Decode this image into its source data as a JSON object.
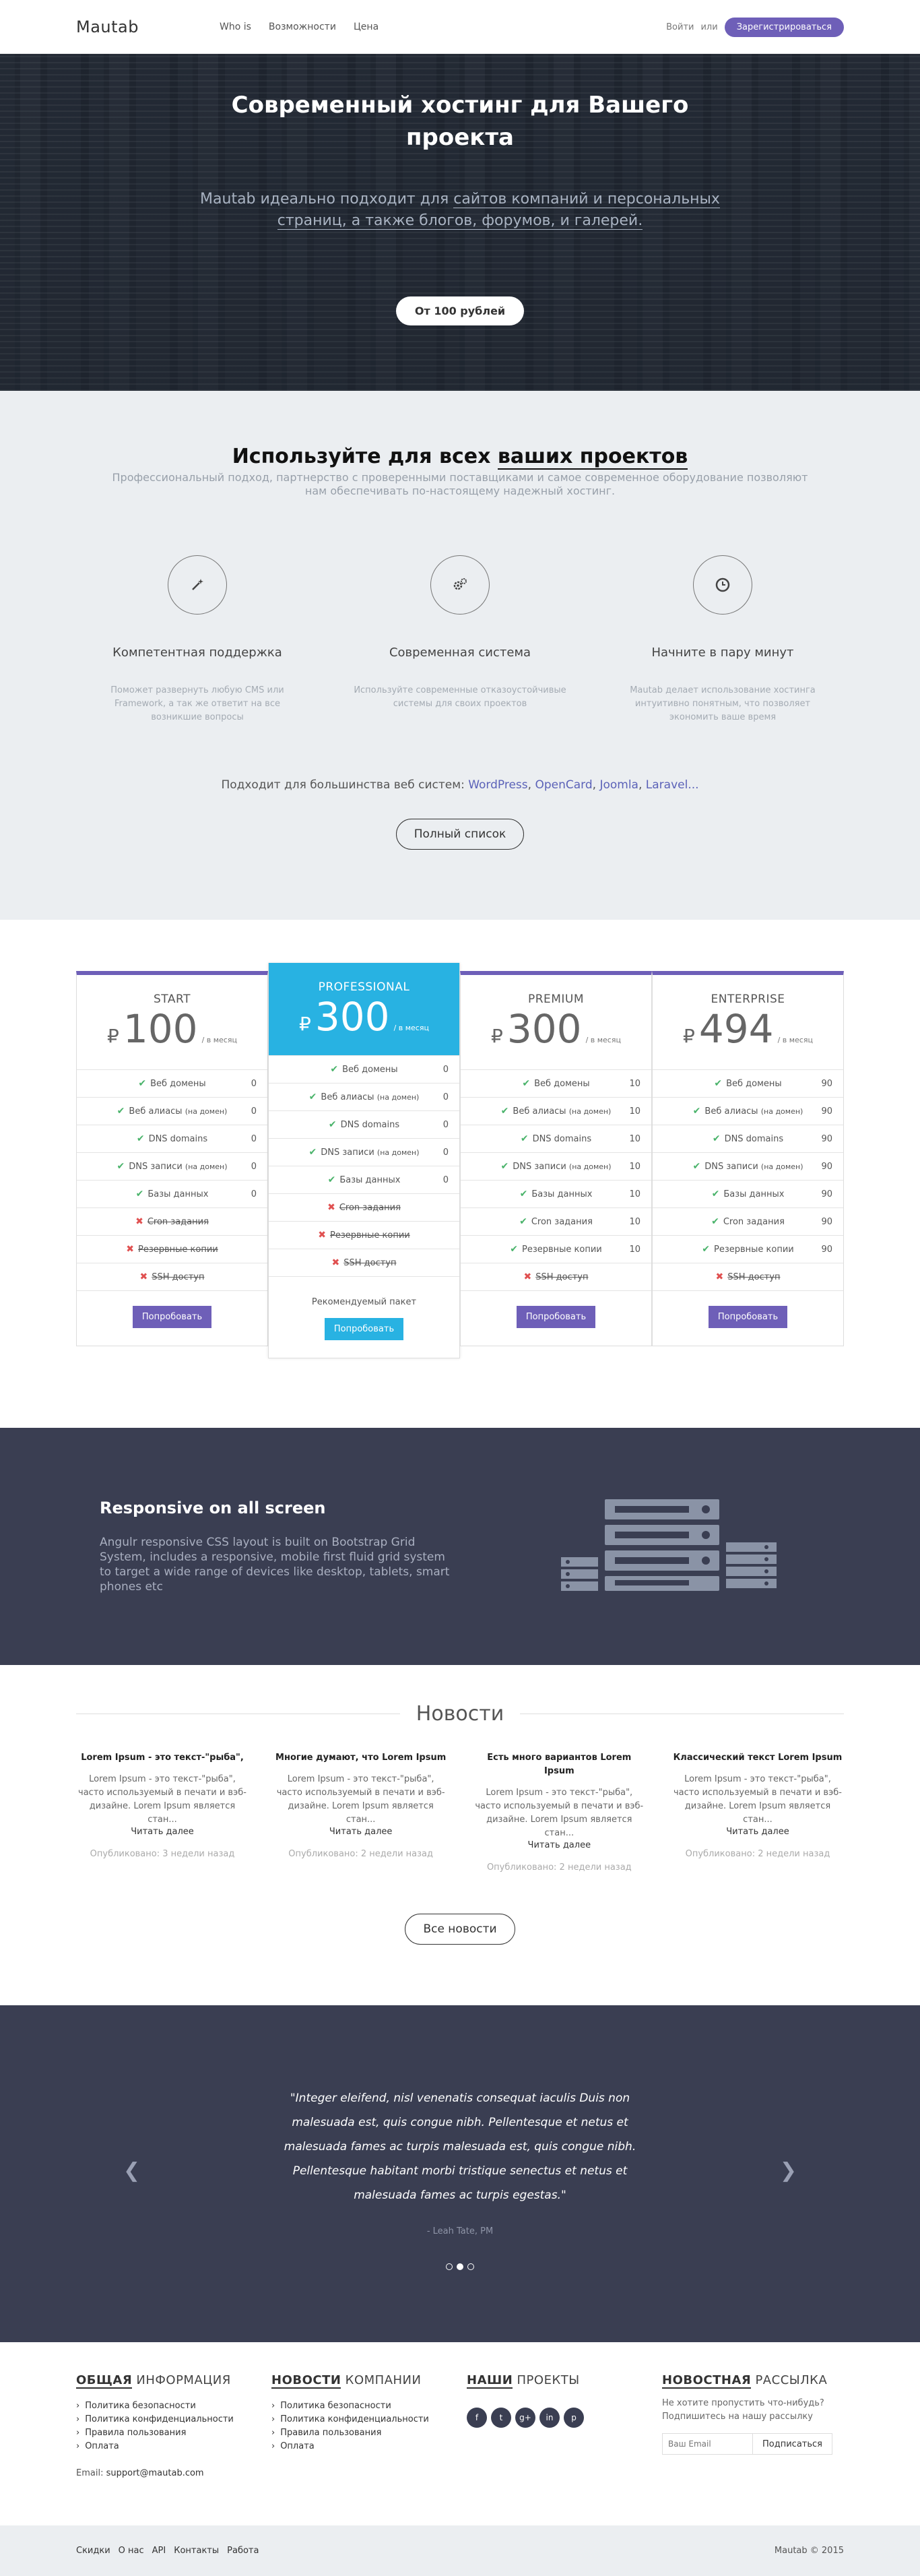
{
  "header": {
    "logo": "Mautab",
    "nav": [
      "Who is",
      "Возможности",
      "Цена"
    ],
    "login": "Войти",
    "or": "или",
    "register": "Зарегистрироваться"
  },
  "hero": {
    "title": "Современный хостинг для Вашего проекта",
    "text_plain": "Mautab идеально подходит для ",
    "text_link": "сайтов компаний и персональных страниц, а также блогов, форумов, и галерей.",
    "cta": "От 100 рублей"
  },
  "features": {
    "title_plain": "Используйте для всех ",
    "title_underlined": "ваших проектов",
    "subtitle": "Профессиональный подход, партнерство с проверенными поставщиками и самое современное оборудование позволяют нам обеспечивать по-настоящему надежный хостинг.",
    "items": [
      {
        "icon": "magic-wand-icon",
        "title": "Компетентная поддержка",
        "text": "Поможет развернуть любую CMS или Framework, а так же ответит на все возникшие вопросы"
      },
      {
        "icon": "gears-icon",
        "title": "Современная система",
        "text": "Используйте современные отказоустойчивые системы для своих проектов"
      },
      {
        "icon": "clock-icon",
        "title": "Начните в пару минут",
        "text": "Mautab делает использование хостинга интуитивно понятным, что позволяет экономить ваше время"
      }
    ],
    "cms_prefix": "Подходит для большинства веб систем:",
    "cms_list": [
      "WordPress",
      "OpenCard",
      "Joomla",
      "Laravel..."
    ],
    "full_list": "Полный список"
  },
  "pricing": {
    "currency": "₽",
    "per": "/ в месяц",
    "plans": [
      {
        "name": "START",
        "price": "100",
        "counts": [
          "0",
          "0",
          "0",
          "0",
          "0"
        ],
        "extra": [
          false,
          false,
          false
        ],
        "button": "Попробовать"
      },
      {
        "name": "PROFESSIONAL",
        "price": "300",
        "counts": [
          "0",
          "0",
          "0",
          "0",
          "0"
        ],
        "extra": [
          false,
          false,
          false
        ],
        "recommended": "Рекомендуемый пакет",
        "button": "Попробовать"
      },
      {
        "name": "PREMIUM",
        "price": "300",
        "counts": [
          "10",
          "10",
          "10",
          "10",
          "10"
        ],
        "extra": [
          true,
          true,
          false
        ],
        "button": "Попробовать"
      },
      {
        "name": "ENTERPRISE",
        "price": "494",
        "counts": [
          "90",
          "90",
          "90",
          "90",
          "90"
        ],
        "extra": [
          true,
          true,
          false
        ],
        "button": "Попробовать"
      }
    ],
    "features": {
      "domains": "Веб домены",
      "aliases": "Веб алиасы",
      "aliases_note": "(на домен)",
      "dns_domains": "DNS domains",
      "dns_records": "DNS записи",
      "dns_note": "(на домен)",
      "databases": "Базы данных",
      "cron": "Cron задания",
      "backups": "Резервные копии",
      "ssh": "SSH доступ"
    }
  },
  "responsive": {
    "title": "Responsive on all screen",
    "text": "Angulr responsive CSS layout is built on Bootstrap Grid System, includes a responsive, mobile first fluid grid system to target a wide range of devices like desktop, tablets, smart phones etc"
  },
  "news": {
    "title": "Новости",
    "items": [
      {
        "title": "Lorem Ipsum - это текст-\"рыба\",",
        "text": "Lorem Ipsum - это текст-\"рыба\", часто используемый в печати и вэб-дизайне. Lorem Ipsum является стан...",
        "more": "Читать далее",
        "date": "Опубликовано: 3 недели назад"
      },
      {
        "title": "Многие думают, что Lorem Ipsum",
        "text": "Lorem Ipsum - это текст-\"рыба\", часто используемый в печати и вэб-дизайне. Lorem Ipsum является стан...",
        "more": "Читать далее",
        "date": "Опубликовано: 2 недели назад"
      },
      {
        "title": "Есть много вариантов Lorem Ipsum",
        "text": "Lorem Ipsum - это текст-\"рыба\", часто используемый в печати и вэб-дизайне. Lorem Ipsum является стан...",
        "more": "Читать далее",
        "date": "Опубликовано: 2 недели назад"
      },
      {
        "title": "Классический текст Lorem Ipsum",
        "text": "Lorem Ipsum - это текст-\"рыба\", часто используемый в печати и вэб-дизайне. Lorem Ipsum является стан...",
        "more": "Читать далее",
        "date": "Опубликовано: 2 недели назад"
      }
    ],
    "all": "Все новости"
  },
  "testimonial": {
    "quote": "\"Integer eleifend, nisl venenatis consequat iaculis Duis non malesuada est, quis congue nibh. Pellentesque et netus et malesuada fames ac turpis malesuada est, quis congue nibh. Pellentesque habitant morbi tristique senectus et netus et malesuada fames ac turpis egestas.\"",
    "author": "- Leah Tate, PM",
    "slides": 3,
    "active_slide": 2
  },
  "footer": {
    "col1_bold": "ОБЩАЯ",
    "col1_rest": " ИНФОРМАЦИЯ",
    "col1_links": [
      "Политика безопасности",
      "Политика конфиденциальности",
      "Правила пользования",
      "Оплата"
    ],
    "email_label": "Email:",
    "email": "support@mautab.com",
    "col2_bold": "НОВОСТИ",
    "col2_rest": " КОМПАНИИ",
    "col2_links": [
      "Политика безопасности",
      "Политика конфиденциальности",
      "Правила пользования",
      "Оплата"
    ],
    "col3_bold": "НАШИ",
    "col3_rest": " ПРОЕКТЫ",
    "social": [
      {
        "icon": "facebook-icon",
        "glyph": "f"
      },
      {
        "icon": "twitter-icon",
        "glyph": "t"
      },
      {
        "icon": "google-plus-icon",
        "glyph": "g+"
      },
      {
        "icon": "linkedin-icon",
        "glyph": "in"
      },
      {
        "icon": "pinterest-icon",
        "glyph": "p"
      }
    ],
    "col4_bold": "НОВОСТНАЯ",
    "col4_rest": " РАССЫЛКА",
    "newsletter_text": "Не хотите пропустить что-нибудь? Подпишитесь на нашу рассылку",
    "newsletter_placeholder": "Ваш Email",
    "subscribe": "Подписаться"
  },
  "bottom": {
    "links": [
      "Скидки",
      "О нас",
      "API",
      "Контакты",
      "Работа"
    ],
    "copyright": "Mautab © 2015"
  },
  "colors": {
    "accent": "#6e5fb8",
    "pro": "#28b2e2",
    "dark": "#3a3e52"
  }
}
